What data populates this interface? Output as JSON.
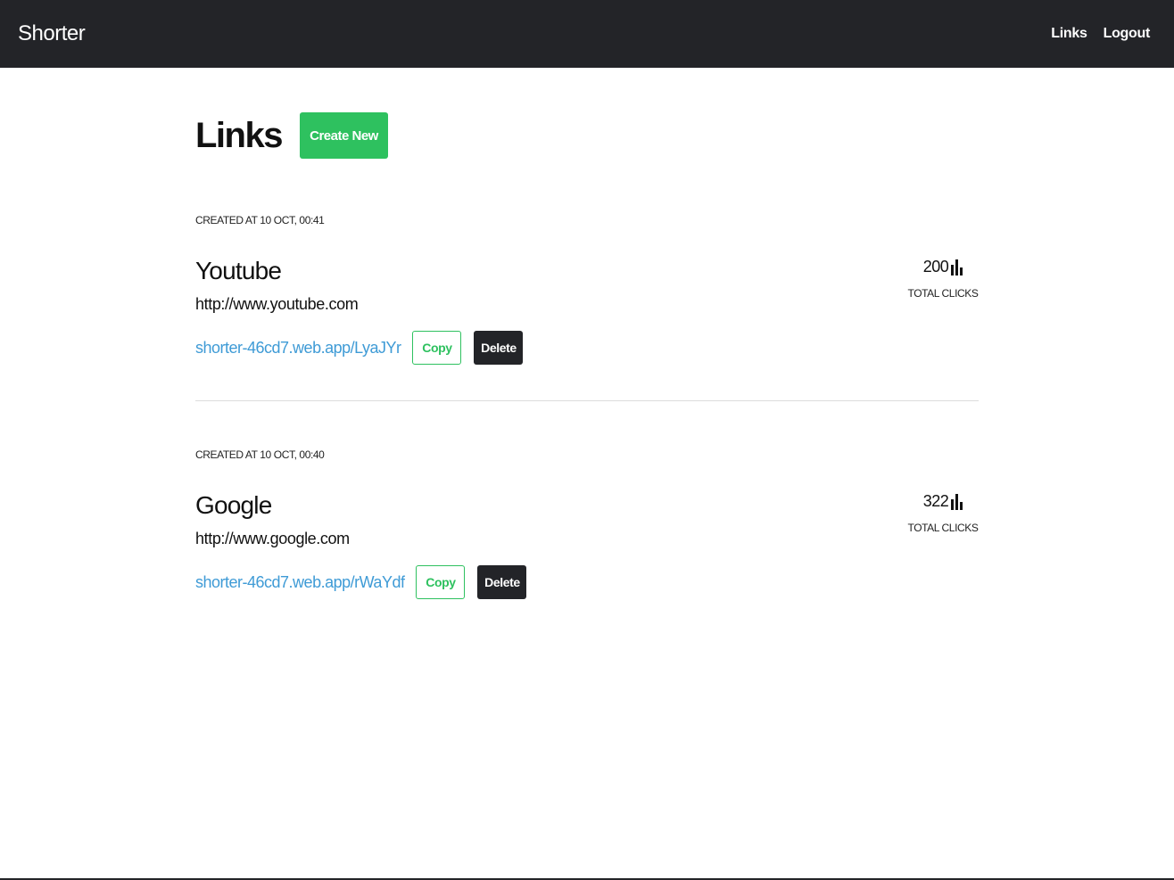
{
  "nav": {
    "brand": "Shorter",
    "links_label": "Links",
    "logout_label": "Logout"
  },
  "page": {
    "title": "Links",
    "create_label": "Create New"
  },
  "links": [
    {
      "created": "CREATED AT 10 OCT, 00:41",
      "name": "Youtube",
      "original": "http://www.youtube.com",
      "short": "shorter-46cd7.web.app/LyaJYr",
      "copy_label": "Copy",
      "delete_label": "Delete",
      "clicks": "200",
      "clicks_label": "TOTAL CLICKS"
    },
    {
      "created": "CREATED AT 10 OCT, 00:40",
      "name": "Google",
      "original": "http://www.google.com",
      "short": "shorter-46cd7.web.app/rWaYdf",
      "copy_label": "Copy",
      "delete_label": "Delete",
      "clicks": "322",
      "clicks_label": "TOTAL CLICKS"
    }
  ],
  "colors": {
    "navbar": "#232428",
    "accent_green": "#2ec15f",
    "link_blue": "#3f9bd6"
  },
  "icons": {
    "clicks": "bar-chart-icon"
  }
}
